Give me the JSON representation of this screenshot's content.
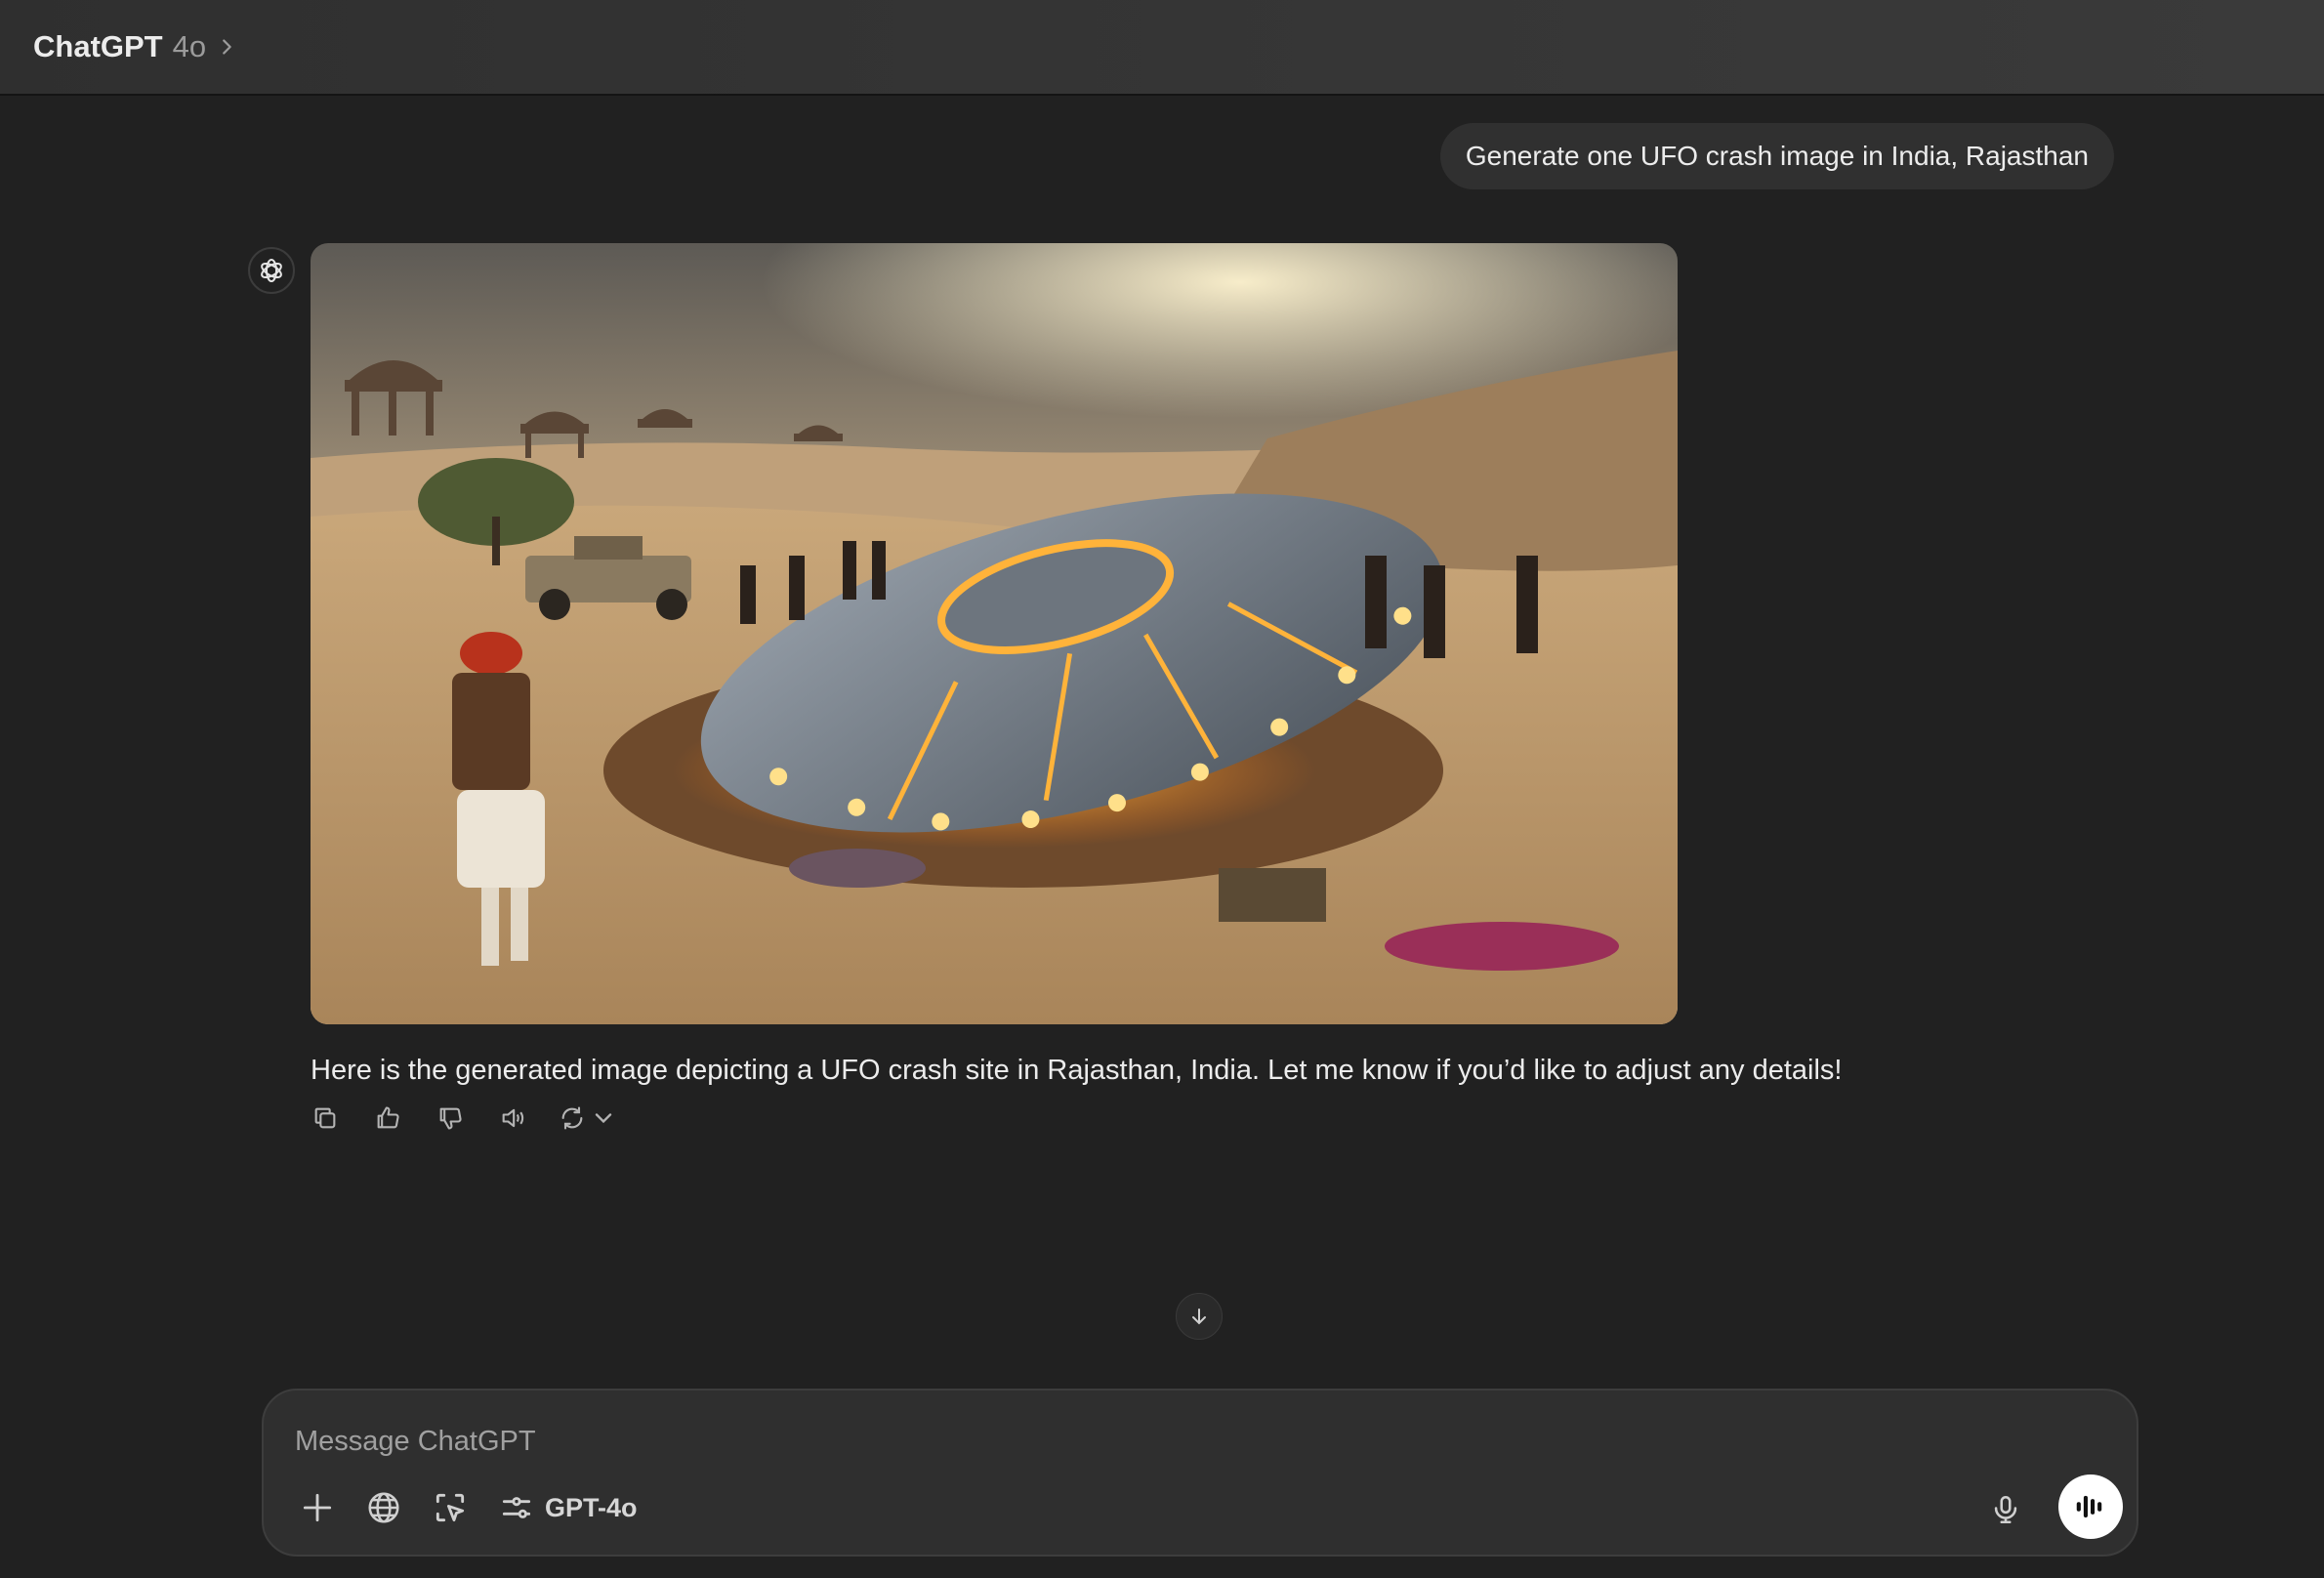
{
  "header": {
    "app_name": "ChatGPT",
    "model_name": "4o"
  },
  "conversation": {
    "user_message": "Generate one UFO crash image in India, Rajasthan",
    "assistant_message": "Here is the generated image depicting a UFO crash site in Rajasthan, India. Let me know if you’d like to adjust any details!",
    "actions": [
      "copy-icon",
      "thumbs-up-icon",
      "thumbs-down-icon",
      "read-aloud-icon",
      "regenerate-icon"
    ]
  },
  "composer": {
    "placeholder": "Message ChatGPT",
    "model_label": "GPT-4o",
    "tools": [
      "plus-icon",
      "globe-icon",
      "select-icon",
      "tools-icon"
    ]
  },
  "colors": {
    "background": "#212121",
    "header": "#333333",
    "bubble": "#303030",
    "composer": "#2f2f2f",
    "text": "#ececec"
  }
}
